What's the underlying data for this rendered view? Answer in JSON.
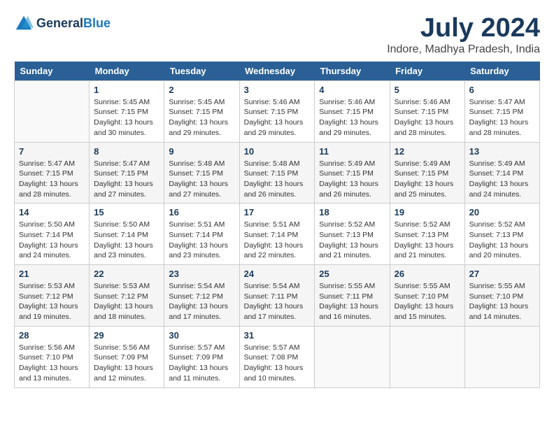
{
  "logo": {
    "line1": "General",
    "line2": "Blue"
  },
  "title": "July 2024",
  "location": "Indore, Madhya Pradesh, India",
  "weekdays": [
    "Sunday",
    "Monday",
    "Tuesday",
    "Wednesday",
    "Thursday",
    "Friday",
    "Saturday"
  ],
  "weeks": [
    [
      {
        "day": "",
        "sunrise": "",
        "sunset": "",
        "daylight": ""
      },
      {
        "day": "1",
        "sunrise": "Sunrise: 5:45 AM",
        "sunset": "Sunset: 7:15 PM",
        "daylight": "Daylight: 13 hours and 30 minutes."
      },
      {
        "day": "2",
        "sunrise": "Sunrise: 5:45 AM",
        "sunset": "Sunset: 7:15 PM",
        "daylight": "Daylight: 13 hours and 29 minutes."
      },
      {
        "day": "3",
        "sunrise": "Sunrise: 5:46 AM",
        "sunset": "Sunset: 7:15 PM",
        "daylight": "Daylight: 13 hours and 29 minutes."
      },
      {
        "day": "4",
        "sunrise": "Sunrise: 5:46 AM",
        "sunset": "Sunset: 7:15 PM",
        "daylight": "Daylight: 13 hours and 29 minutes."
      },
      {
        "day": "5",
        "sunrise": "Sunrise: 5:46 AM",
        "sunset": "Sunset: 7:15 PM",
        "daylight": "Daylight: 13 hours and 28 minutes."
      },
      {
        "day": "6",
        "sunrise": "Sunrise: 5:47 AM",
        "sunset": "Sunset: 7:15 PM",
        "daylight": "Daylight: 13 hours and 28 minutes."
      }
    ],
    [
      {
        "day": "7",
        "sunrise": "Sunrise: 5:47 AM",
        "sunset": "Sunset: 7:15 PM",
        "daylight": "Daylight: 13 hours and 28 minutes."
      },
      {
        "day": "8",
        "sunrise": "Sunrise: 5:47 AM",
        "sunset": "Sunset: 7:15 PM",
        "daylight": "Daylight: 13 hours and 27 minutes."
      },
      {
        "day": "9",
        "sunrise": "Sunrise: 5:48 AM",
        "sunset": "Sunset: 7:15 PM",
        "daylight": "Daylight: 13 hours and 27 minutes."
      },
      {
        "day": "10",
        "sunrise": "Sunrise: 5:48 AM",
        "sunset": "Sunset: 7:15 PM",
        "daylight": "Daylight: 13 hours and 26 minutes."
      },
      {
        "day": "11",
        "sunrise": "Sunrise: 5:49 AM",
        "sunset": "Sunset: 7:15 PM",
        "daylight": "Daylight: 13 hours and 26 minutes."
      },
      {
        "day": "12",
        "sunrise": "Sunrise: 5:49 AM",
        "sunset": "Sunset: 7:15 PM",
        "daylight": "Daylight: 13 hours and 25 minutes."
      },
      {
        "day": "13",
        "sunrise": "Sunrise: 5:49 AM",
        "sunset": "Sunset: 7:14 PM",
        "daylight": "Daylight: 13 hours and 24 minutes."
      }
    ],
    [
      {
        "day": "14",
        "sunrise": "Sunrise: 5:50 AM",
        "sunset": "Sunset: 7:14 PM",
        "daylight": "Daylight: 13 hours and 24 minutes."
      },
      {
        "day": "15",
        "sunrise": "Sunrise: 5:50 AM",
        "sunset": "Sunset: 7:14 PM",
        "daylight": "Daylight: 13 hours and 23 minutes."
      },
      {
        "day": "16",
        "sunrise": "Sunrise: 5:51 AM",
        "sunset": "Sunset: 7:14 PM",
        "daylight": "Daylight: 13 hours and 23 minutes."
      },
      {
        "day": "17",
        "sunrise": "Sunrise: 5:51 AM",
        "sunset": "Sunset: 7:14 PM",
        "daylight": "Daylight: 13 hours and 22 minutes."
      },
      {
        "day": "18",
        "sunrise": "Sunrise: 5:52 AM",
        "sunset": "Sunset: 7:13 PM",
        "daylight": "Daylight: 13 hours and 21 minutes."
      },
      {
        "day": "19",
        "sunrise": "Sunrise: 5:52 AM",
        "sunset": "Sunset: 7:13 PM",
        "daylight": "Daylight: 13 hours and 21 minutes."
      },
      {
        "day": "20",
        "sunrise": "Sunrise: 5:52 AM",
        "sunset": "Sunset: 7:13 PM",
        "daylight": "Daylight: 13 hours and 20 minutes."
      }
    ],
    [
      {
        "day": "21",
        "sunrise": "Sunrise: 5:53 AM",
        "sunset": "Sunset: 7:12 PM",
        "daylight": "Daylight: 13 hours and 19 minutes."
      },
      {
        "day": "22",
        "sunrise": "Sunrise: 5:53 AM",
        "sunset": "Sunset: 7:12 PM",
        "daylight": "Daylight: 13 hours and 18 minutes."
      },
      {
        "day": "23",
        "sunrise": "Sunrise: 5:54 AM",
        "sunset": "Sunset: 7:12 PM",
        "daylight": "Daylight: 13 hours and 17 minutes."
      },
      {
        "day": "24",
        "sunrise": "Sunrise: 5:54 AM",
        "sunset": "Sunset: 7:11 PM",
        "daylight": "Daylight: 13 hours and 17 minutes."
      },
      {
        "day": "25",
        "sunrise": "Sunrise: 5:55 AM",
        "sunset": "Sunset: 7:11 PM",
        "daylight": "Daylight: 13 hours and 16 minutes."
      },
      {
        "day": "26",
        "sunrise": "Sunrise: 5:55 AM",
        "sunset": "Sunset: 7:10 PM",
        "daylight": "Daylight: 13 hours and 15 minutes."
      },
      {
        "day": "27",
        "sunrise": "Sunrise: 5:55 AM",
        "sunset": "Sunset: 7:10 PM",
        "daylight": "Daylight: 13 hours and 14 minutes."
      }
    ],
    [
      {
        "day": "28",
        "sunrise": "Sunrise: 5:56 AM",
        "sunset": "Sunset: 7:10 PM",
        "daylight": "Daylight: 13 hours and 13 minutes."
      },
      {
        "day": "29",
        "sunrise": "Sunrise: 5:56 AM",
        "sunset": "Sunset: 7:09 PM",
        "daylight": "Daylight: 13 hours and 12 minutes."
      },
      {
        "day": "30",
        "sunrise": "Sunrise: 5:57 AM",
        "sunset": "Sunset: 7:09 PM",
        "daylight": "Daylight: 13 hours and 11 minutes."
      },
      {
        "day": "31",
        "sunrise": "Sunrise: 5:57 AM",
        "sunset": "Sunset: 7:08 PM",
        "daylight": "Daylight: 13 hours and 10 minutes."
      },
      {
        "day": "",
        "sunrise": "",
        "sunset": "",
        "daylight": ""
      },
      {
        "day": "",
        "sunrise": "",
        "sunset": "",
        "daylight": ""
      },
      {
        "day": "",
        "sunrise": "",
        "sunset": "",
        "daylight": ""
      }
    ]
  ]
}
